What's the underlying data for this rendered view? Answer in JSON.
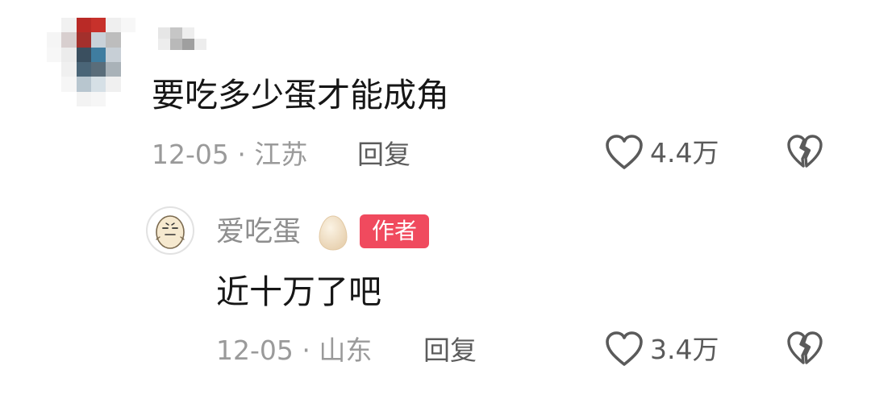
{
  "comment": {
    "text": "要吃多少蛋才能成角",
    "date": "12-05",
    "separator": "·",
    "location": "江苏",
    "reply_label": "回复",
    "like_count": "4.4万"
  },
  "reply": {
    "username": "爱吃蛋",
    "username_emoji": "egg-emoji",
    "badge": "作者",
    "text": "近十万了吧",
    "date": "12-05",
    "separator": "·",
    "location": "山东",
    "reply_label": "回复",
    "like_count": "3.4万"
  },
  "icons": {
    "like": "heart-outline-icon",
    "dislike": "broken-heart-icon"
  },
  "colors": {
    "badge_bg": "#f04a5e",
    "meta_text": "#9a9a9a",
    "primary_text": "#161616"
  }
}
